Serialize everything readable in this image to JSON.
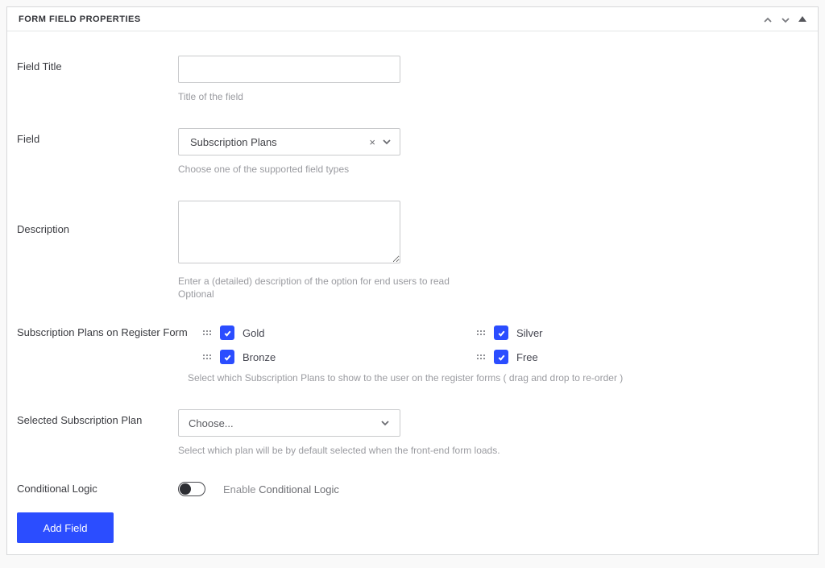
{
  "header": {
    "title": "FORM FIELD PROPERTIES"
  },
  "fieldTitle": {
    "label": "Field Title",
    "value": "",
    "helper": "Title of the field"
  },
  "fieldType": {
    "label": "Field",
    "selected": "Subscription Plans",
    "helper": "Choose one of the supported field types"
  },
  "description": {
    "label": "Description",
    "value": "",
    "helper1": "Enter a (detailed) description of the option for end users to read",
    "helper2": "Optional"
  },
  "plans": {
    "label": "Subscription Plans on Register Form",
    "items": [
      "Gold",
      "Silver",
      "Bronze",
      "Free"
    ],
    "helper": "Select which Subscription Plans to show to the user on the register forms ( drag and drop to re-order )"
  },
  "selectedPlan": {
    "label": "Selected Subscription Plan",
    "placeholder": "Choose...",
    "helper": "Select which plan will be by default selected when the front-end form loads."
  },
  "conditionalLogic": {
    "label": "Conditional Logic",
    "toggleLabelPrefix": "Enable ",
    "toggleLabelEm": "Conditional Logic"
  },
  "addField": {
    "label": "Add Field"
  }
}
